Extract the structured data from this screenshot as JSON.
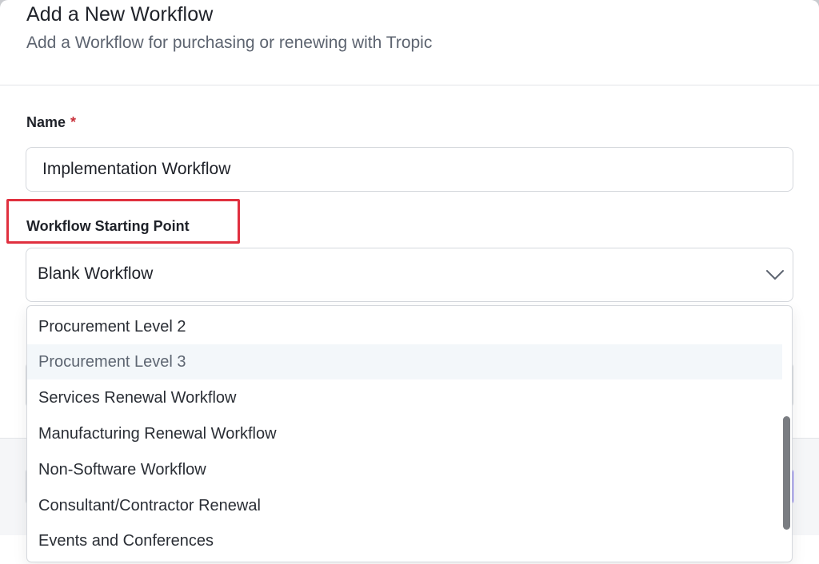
{
  "header": {
    "title": "Add a New Workflow",
    "subtitle": "Add a Workflow for purchasing or renewing with Tropic"
  },
  "form": {
    "name_label": "Name",
    "required_marker": "*",
    "name_value": "Implementation Workflow",
    "starting_point_label": "Workflow Starting Point",
    "starting_point_selected": "Blank Workflow"
  },
  "dropdown": {
    "options": [
      "Procurement Level 2",
      "Procurement Level 3",
      "Services Renewal Workflow",
      "Manufacturing Renewal Workflow",
      "Non-Software Workflow",
      "Consultant/Contractor Renewal",
      "Events and Conferences"
    ],
    "hovered_index": 1
  },
  "colors": {
    "highlight": "#e0303f",
    "required": "#c8313b",
    "primary": "#6b5cf0"
  },
  "icons": {
    "select_chevron": "chevron-down-icon"
  }
}
